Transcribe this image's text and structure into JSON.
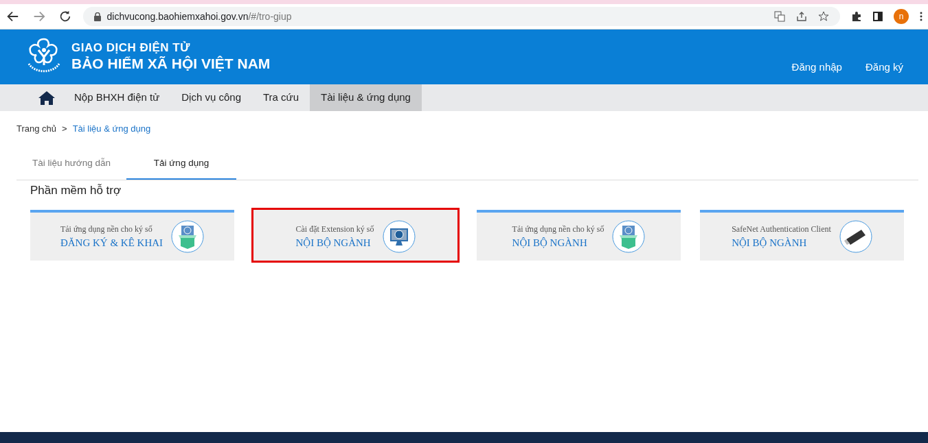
{
  "browser": {
    "url_host": "dichvucong.baohiemxahoi.gov.vn",
    "url_path": "/#/tro-giup",
    "profile_initial": "n"
  },
  "header": {
    "subtitle": "GIAO DỊCH ĐIỆN TỬ",
    "title": "BẢO HIỂM XÃ HỘI VIỆT NAM",
    "links": [
      "Đăng nhập",
      "Đăng ký"
    ]
  },
  "nav": [
    {
      "label": "Nộp BHXH điện tử",
      "selected": false
    },
    {
      "label": "Dịch vụ công",
      "selected": false
    },
    {
      "label": "Tra cứu",
      "selected": false
    },
    {
      "label": "Tài liệu & ứng dụng",
      "selected": true
    }
  ],
  "breadcrumb": [
    "Trang chủ",
    "Tài liệu & ứng dụng"
  ],
  "breadcrumb_separator": ">",
  "tabs": [
    {
      "label": "Tài liệu hướng dẫn",
      "selected": false
    },
    {
      "label": "Tải ứng dụng",
      "selected": true
    }
  ],
  "section_title": "Phần mềm hỗ trợ",
  "cards": [
    {
      "caption": "Tải ứng dụng nền cho ký số",
      "title": "ĐĂNG KÝ & KÊ KHAI",
      "kind": "box",
      "highlighted": false
    },
    {
      "caption": "Cài đặt Extension ký số",
      "title": "NỘI BỘ NGÀNH",
      "kind": "monitor",
      "highlighted": true
    },
    {
      "caption": "Tải ứng dụng nền cho ký số",
      "title": "NỘI BỘ NGÀNH",
      "kind": "box",
      "highlighted": false
    },
    {
      "caption": "SafeNet Authentication Client",
      "title": "NỘI BỘ NGÀNH",
      "kind": "usb",
      "highlighted": false
    }
  ]
}
